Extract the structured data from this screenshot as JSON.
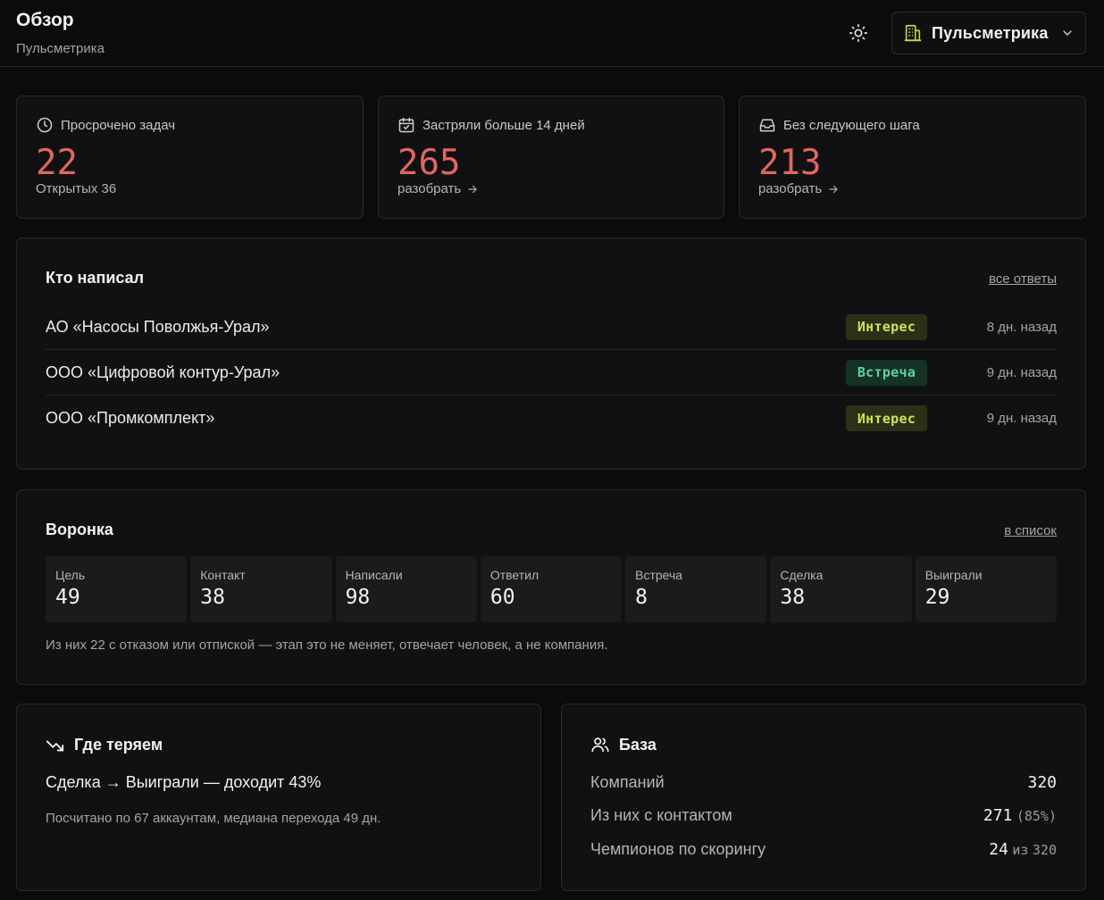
{
  "header": {
    "title": "Обзор",
    "subtitle": "Пульсметрика",
    "theme_icon": "sun-icon",
    "workspace": {
      "label": "Пульсметрика",
      "icon": "building-icon",
      "accent": "#b8d94a"
    }
  },
  "stats": [
    {
      "icon": "clock-icon",
      "label": "Просрочено задач",
      "value": "22",
      "foot": "Открытых 36",
      "is_link": false
    },
    {
      "icon": "calendar-check-icon",
      "label": "Застряли больше 14 дней",
      "value": "265",
      "foot": "разобрать",
      "is_link": true
    },
    {
      "icon": "inbox-icon",
      "label": "Без следующего шага",
      "value": "213",
      "foot": "разобрать",
      "is_link": true
    }
  ],
  "replies": {
    "title": "Кто написал",
    "link": "все ответы",
    "rows": [
      {
        "company": "АО «Насосы Поволжья-Урал»",
        "status": "Интерес",
        "time": "8 дн. назад"
      },
      {
        "company": "ООО «Цифровой контур-Урал»",
        "status": "Встреча",
        "time": "9 дн. назад"
      },
      {
        "company": "ООО «Промкомплект»",
        "status": "Интерес",
        "time": "9 дн. назад"
      }
    ]
  },
  "funnel": {
    "title": "Воронка",
    "link": "в список",
    "stages": [
      {
        "label": "Цель",
        "value": "49"
      },
      {
        "label": "Контакт",
        "value": "38"
      },
      {
        "label": "Написали",
        "value": "98"
      },
      {
        "label": "Ответил",
        "value": "60"
      },
      {
        "label": "Встреча",
        "value": "8"
      },
      {
        "label": "Сделка",
        "value": "38"
      },
      {
        "label": "Выиграли",
        "value": "29"
      }
    ],
    "note": "Из них 22 с отказом или отпиской — этап это не меняет, отвечает человек, а не компания."
  },
  "losses": {
    "title": "Где теряем",
    "icon": "trending-down-icon",
    "main": "Сделка → Выиграли — доходит 43%",
    "note": "Посчитано по 67 аккаунтам, медиана перехода 49 дн."
  },
  "base": {
    "title": "База",
    "icon": "users-icon",
    "companies_label": "Компаний",
    "companies_value": "320",
    "with_contact_label": "Из них с контактом",
    "with_contact_value": "271",
    "with_contact_pct": "(85%)",
    "champions_label": "Чемпионов по скорингу",
    "champions_value": "24",
    "champions_of": "из",
    "champions_total": "320"
  },
  "colors": {
    "danger": "#e0675e",
    "badge_interest": "#d2e25a",
    "badge_meeting": "#5fd39a"
  }
}
